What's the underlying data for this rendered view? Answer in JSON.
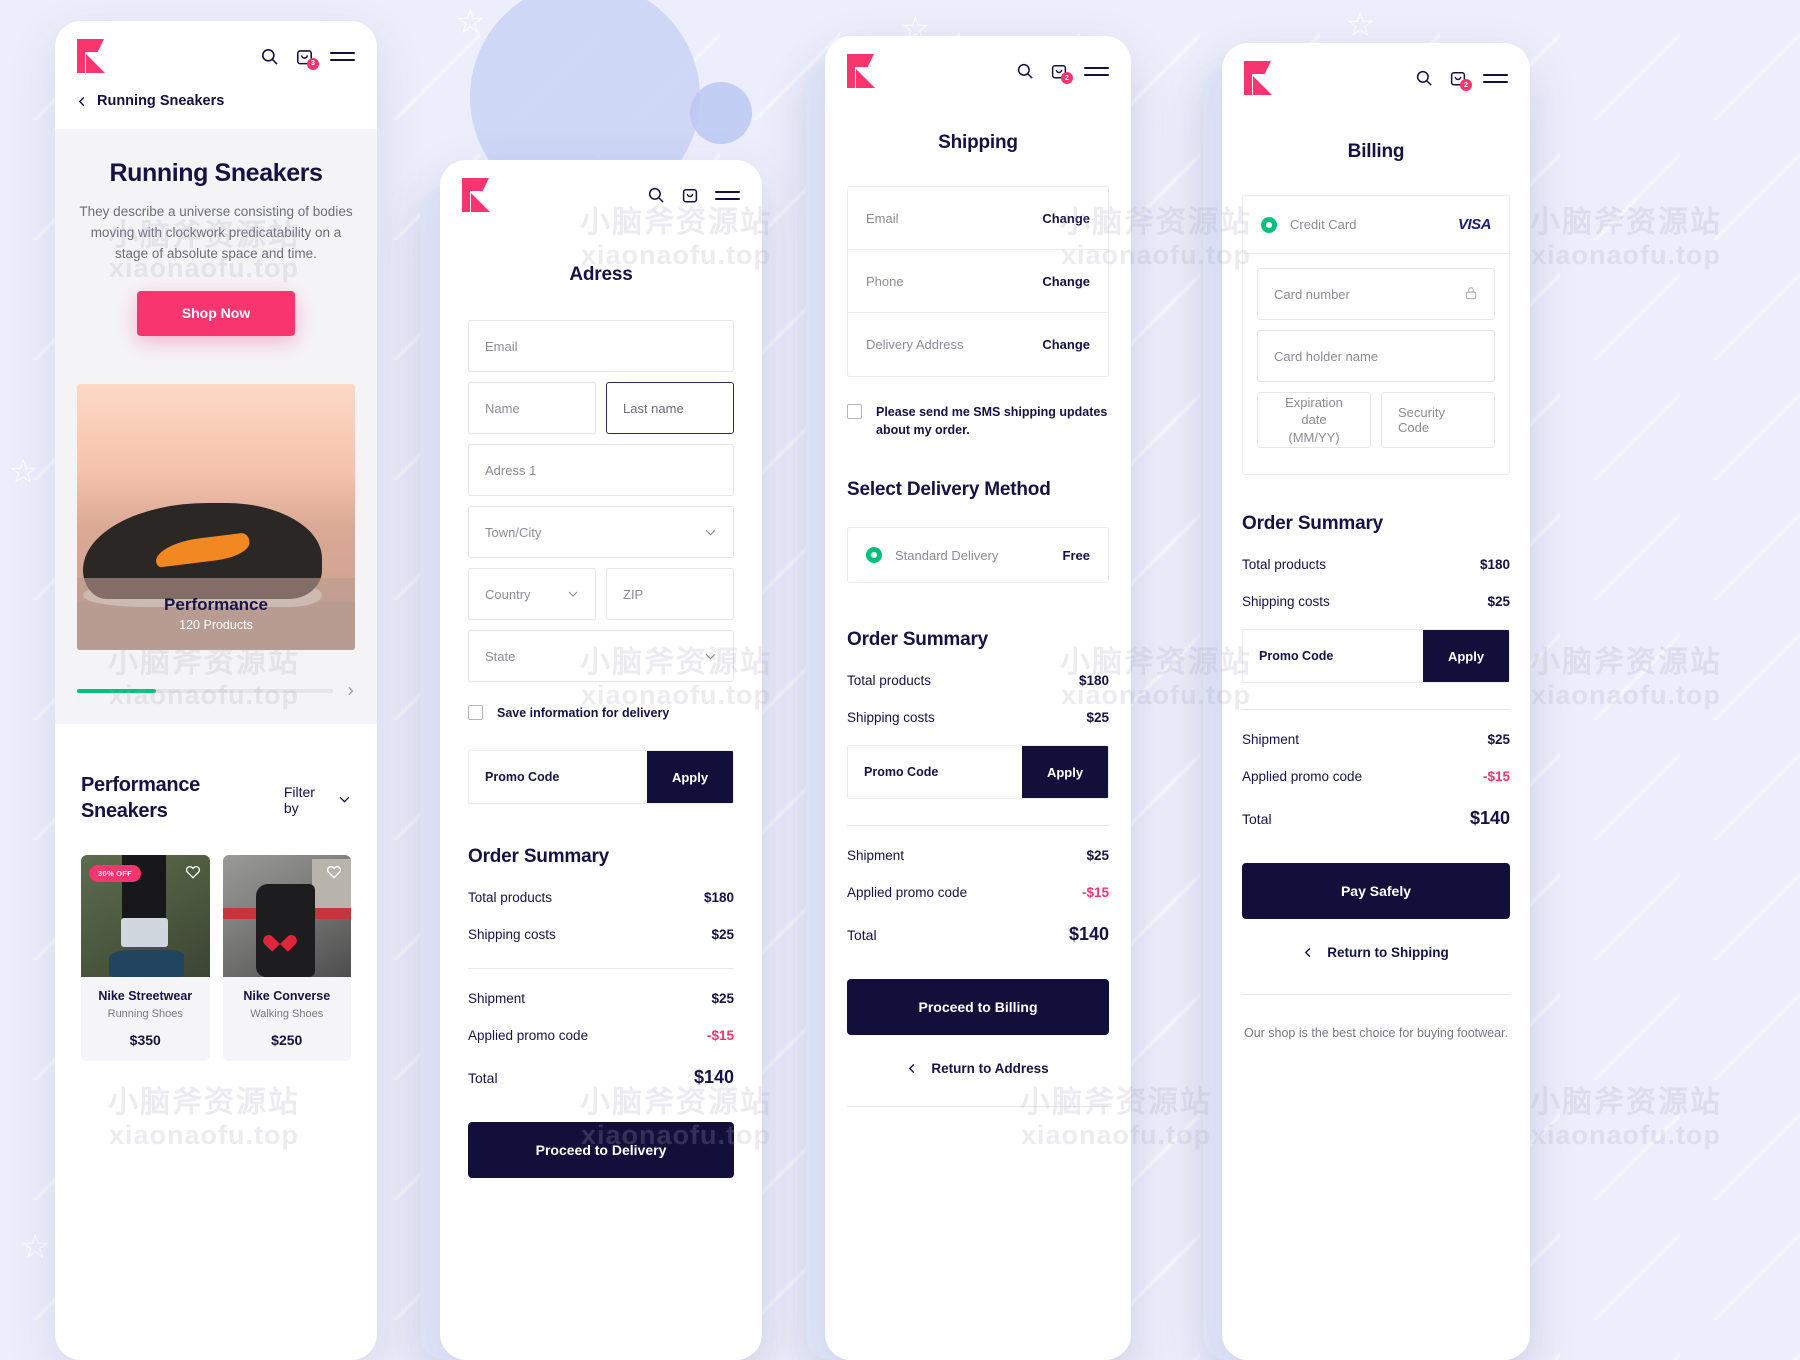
{
  "brand": {
    "logo_name": "K",
    "accent": "#f8356e",
    "dark": "#12103b",
    "green": "#05c07c"
  },
  "watermark": {
    "line1": "小脑斧资源站",
    "line2": "xiaonaofu.top"
  },
  "screen1": {
    "header": {
      "search_icon": "search-icon",
      "bag_icon": "shopping-bag-icon",
      "bag_count": "3",
      "menu_icon": "hamburger-menu-icon"
    },
    "breadcrumb": {
      "back_icon": "chevron-left-icon",
      "label": "Running Sneakers"
    },
    "hero": {
      "title": "Running Sneakers",
      "description": "They describe a universe consisting of bodies moving with clockwork predicatability on a stage of absolute space and time.",
      "cta": "Shop Now"
    },
    "category_card": {
      "title": "Performance",
      "subtitle": "120 Products",
      "progress_percent": 31,
      "next_icon": "chevron-right-icon"
    },
    "section": {
      "title": "Performance Sneakers",
      "filter_label": "Filter by",
      "filter_icon": "chevron-down-icon"
    },
    "products": [
      {
        "badge": "30% OFF",
        "name": "Nike Streetwear",
        "category": "Running Shoes",
        "price": "$350",
        "fav_icon": "heart-icon"
      },
      {
        "badge": "",
        "name": "Nike Converse",
        "category": "Walking Shoes",
        "price": "$250",
        "fav_icon": "heart-icon"
      }
    ]
  },
  "screen2": {
    "header": {
      "search_icon": "search-icon",
      "bag_icon": "shopping-bag-icon",
      "menu_icon": "hamburger-menu-icon"
    },
    "title": "Adress",
    "fields": {
      "email": "Email",
      "name": "Name",
      "last_name": "Last name",
      "address1": "Adress 1",
      "town_city": "Town/City",
      "country": "Country",
      "zip": "ZIP",
      "state": "State"
    },
    "save_info_label": "Save information for delivery",
    "promo": {
      "placeholder": "Promo Code",
      "apply": "Apply"
    },
    "summary": {
      "title": "Order Summary",
      "rows": [
        {
          "label": "Total products",
          "value": "$180"
        },
        {
          "label": "Shipping costs",
          "value": "$25"
        }
      ],
      "rows2": [
        {
          "label": "Shipment",
          "value": "$25"
        },
        {
          "label": "Applied promo code",
          "value": "-$15",
          "negative": true
        }
      ],
      "total_label": "Total",
      "total_value": "$140"
    },
    "cta": "Proceed to Delivery"
  },
  "screen3": {
    "header": {
      "search_icon": "search-icon",
      "bag_icon": "shopping-bag-icon",
      "bag_count": "2",
      "menu_icon": "hamburger-menu-icon"
    },
    "title": "Shipping",
    "info_rows": [
      {
        "label": "Email",
        "action": "Change"
      },
      {
        "label": "Phone",
        "action": "Change"
      },
      {
        "label": "Delivery Address",
        "action": "Change"
      }
    ],
    "sms_label": "Please send me SMS shipping updates about my order.",
    "delivery_title": "Select Delivery Method",
    "delivery_option": {
      "label": "Standard Delivery",
      "price": "Free",
      "selected": true
    },
    "promo": {
      "placeholder": "Promo Code",
      "apply": "Apply"
    },
    "summary": {
      "title": "Order Summary",
      "rows": [
        {
          "label": "Total products",
          "value": "$180"
        },
        {
          "label": "Shipping costs",
          "value": "$25"
        }
      ],
      "rows2": [
        {
          "label": "Shipment",
          "value": "$25"
        },
        {
          "label": "Applied promo code",
          "value": "-$15",
          "negative": true
        }
      ],
      "total_label": "Total",
      "total_value": "$140"
    },
    "cta": "Proceed to Billing",
    "back": {
      "icon": "chevron-left-icon",
      "label": "Return to Address"
    }
  },
  "screen4": {
    "header": {
      "search_icon": "search-icon",
      "bag_icon": "shopping-bag-icon",
      "bag_count": "2",
      "menu_icon": "hamburger-menu-icon"
    },
    "title": "Billing",
    "payment": {
      "method": "Credit Card",
      "card_brand": "VISA",
      "selected": true
    },
    "fields": {
      "card_number": "Card number",
      "card_holder": "Card holder name",
      "expiration": "Expiration date (MM/YY)",
      "security": "Security Code",
      "lock_icon": "lock-icon"
    },
    "summary": {
      "title": "Order Summary",
      "rows": [
        {
          "label": "Total products",
          "value": "$180"
        },
        {
          "label": "Shipping costs",
          "value": "$25"
        }
      ],
      "rows2": [
        {
          "label": "Shipment",
          "value": "$25"
        },
        {
          "label": "Applied promo code",
          "value": "-$15",
          "negative": true
        }
      ],
      "total_label": "Total",
      "total_value": "$140"
    },
    "promo": {
      "placeholder": "Promo Code",
      "apply": "Apply"
    },
    "cta": "Pay Safely",
    "back": {
      "icon": "chevron-left-icon",
      "label": "Return to Shipping"
    },
    "footer": "Our shop is the best choice for buying footwear."
  }
}
